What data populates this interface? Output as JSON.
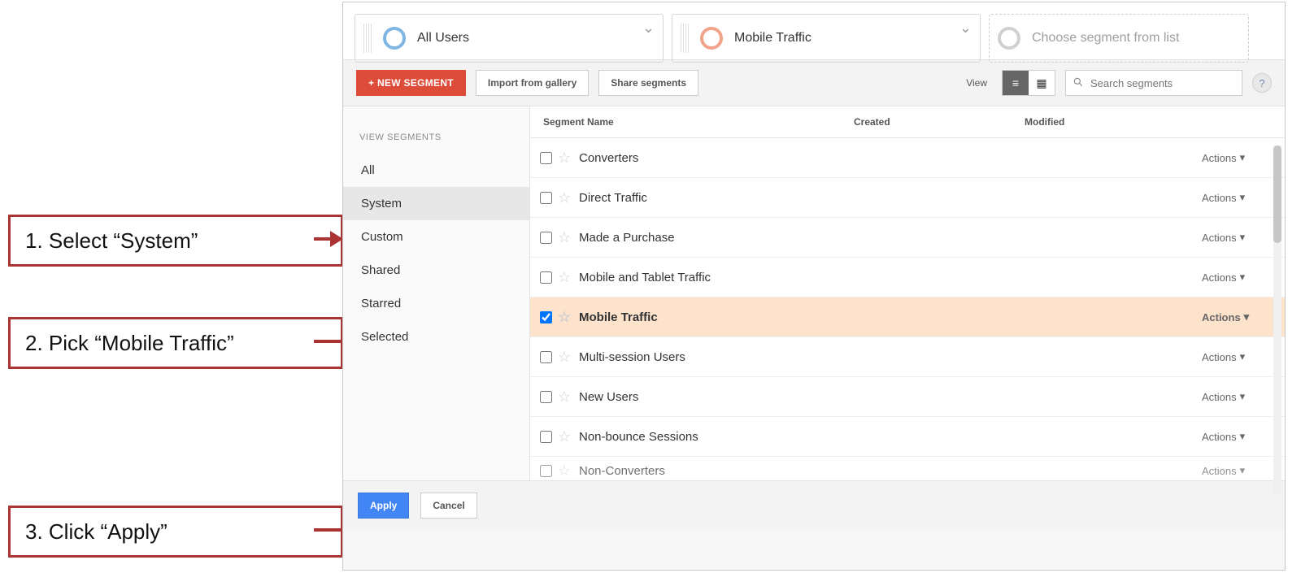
{
  "annotations": {
    "step1": "1. Select “System”",
    "step2": "2. Pick “Mobile Traffic”",
    "step3": "3. Click “Apply”"
  },
  "segments_bar": {
    "card1": "All Users",
    "card2": "Mobile Traffic",
    "placeholder": "Choose segment from list"
  },
  "toolbar": {
    "new_segment": "+ NEW SEGMENT",
    "import": "Import from gallery",
    "share": "Share segments",
    "view_label": "View",
    "search_placeholder": "Search segments"
  },
  "side": {
    "title": "VIEW SEGMENTS",
    "items": {
      "all": "All",
      "system": "System",
      "custom": "Custom",
      "shared": "Shared",
      "starred": "Starred",
      "selected": "Selected"
    }
  },
  "columns": {
    "name": "Segment Name",
    "created": "Created",
    "modified": "Modified"
  },
  "rows": {
    "r0": {
      "name": "Converters"
    },
    "r1": {
      "name": "Direct Traffic"
    },
    "r2": {
      "name": "Made a Purchase"
    },
    "r3": {
      "name": "Mobile and Tablet Traffic"
    },
    "r4": {
      "name": "Mobile Traffic"
    },
    "r5": {
      "name": "Multi-session Users"
    },
    "r6": {
      "name": "New Users"
    },
    "r7": {
      "name": "Non-bounce Sessions"
    },
    "r8": {
      "name": "Non-Converters"
    }
  },
  "actions_label": "Actions",
  "footer": {
    "apply": "Apply",
    "cancel": "Cancel"
  }
}
